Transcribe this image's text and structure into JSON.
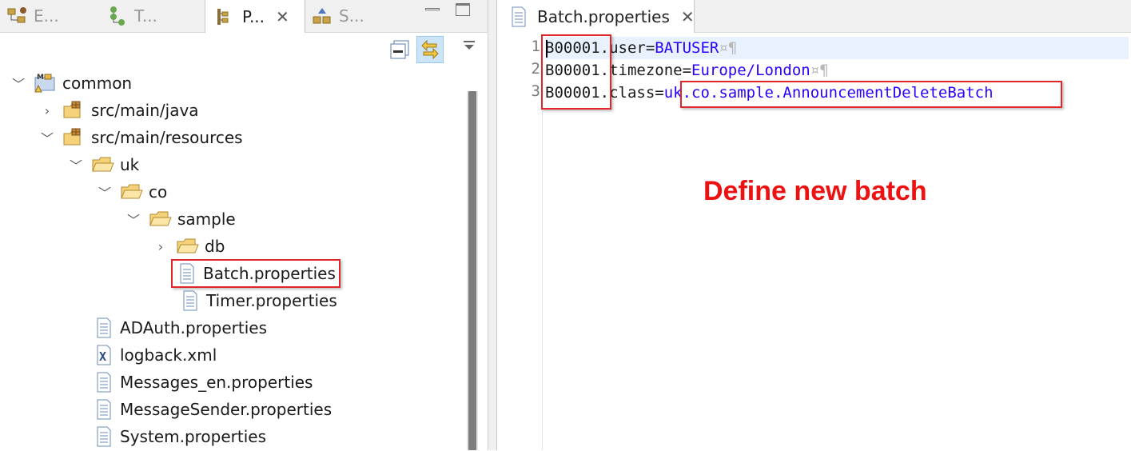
{
  "left_tabs": [
    {
      "label": "E...",
      "icon": "explorer-icon",
      "active": false
    },
    {
      "label": "T...",
      "icon": "type-hierarchy-icon",
      "active": false
    },
    {
      "label": "P...",
      "icon": "package-explorer-icon",
      "active": true
    },
    {
      "label": "S...",
      "icon": "servers-icon",
      "active": false
    }
  ],
  "tree": [
    {
      "label": "common",
      "icon": "maven-project-icon",
      "expanded": true,
      "selected": false
    },
    {
      "label": "src/main/java",
      "icon": "source-folder-icon",
      "expanded": false,
      "selected": false
    },
    {
      "label": "src/main/resources",
      "icon": "source-folder-icon",
      "expanded": true,
      "selected": false
    },
    {
      "label": "uk",
      "icon": "folder-icon",
      "expanded": true,
      "selected": false
    },
    {
      "label": "co",
      "icon": "folder-icon",
      "expanded": true,
      "selected": false
    },
    {
      "label": "sample",
      "icon": "folder-icon",
      "expanded": true,
      "selected": false
    },
    {
      "label": "db",
      "icon": "folder-icon",
      "expanded": false,
      "selected": false
    },
    {
      "label": "Batch.properties",
      "icon": "properties-file-icon",
      "selected": true
    },
    {
      "label": "Timer.properties",
      "icon": "properties-file-icon",
      "selected": false
    },
    {
      "label": "ADAuth.properties",
      "icon": "properties-file-icon",
      "selected": false
    },
    {
      "label": "logback.xml",
      "icon": "xml-file-icon",
      "selected": false
    },
    {
      "label": "Messages_en.properties",
      "icon": "properties-file-icon",
      "selected": false
    },
    {
      "label": "MessageSender.properties",
      "icon": "properties-file-icon",
      "selected": false
    },
    {
      "label": "System.properties",
      "icon": "properties-file-icon",
      "selected": false
    }
  ],
  "editor": {
    "tab_label": "Batch.properties",
    "lines": [
      {
        "number": "1",
        "key": "B00001",
        "rest": ".user=",
        "value": "BATUSER",
        "ws": "¤¶"
      },
      {
        "number": "2",
        "key": "B00001",
        "rest": ".timezone=",
        "value": "Europe/London",
        "ws": "¤¶"
      },
      {
        "number": "3",
        "key": "B00001",
        "rest": ".class=",
        "value": "uk.co.sample.AnnouncementDeleteBatch",
        "ws": ""
      }
    ]
  },
  "annotation": "Define new batch",
  "colors": {
    "annotation": "#ee1111",
    "highlight_border": "#e0262b",
    "property_value": "#2a00ff",
    "current_line": "#e8f2fe"
  }
}
